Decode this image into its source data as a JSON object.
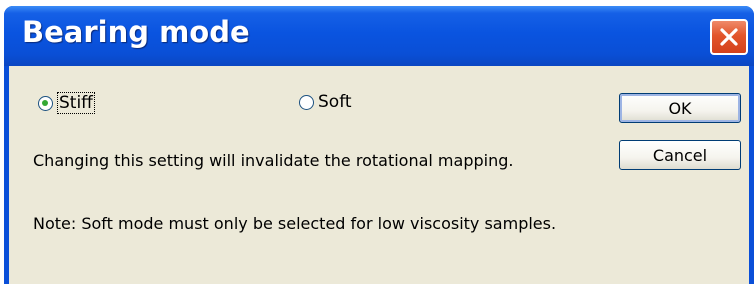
{
  "window": {
    "title": "Bearing mode",
    "close_icon": "close-icon"
  },
  "options": {
    "stiff_label": "Stiff",
    "soft_label": "Soft",
    "selected": "Stiff"
  },
  "buttons": {
    "ok_label": "OK",
    "cancel_label": "Cancel"
  },
  "messages": {
    "warning": "Changing this setting will invalidate the rotational mapping.",
    "note": "Note: Soft mode must only be selected for low viscosity samples."
  },
  "colors": {
    "titlebar": "#0a54e0",
    "client_bg": "#ece9d8",
    "close_button": "#e2552b",
    "radio_dot": "#34a834"
  }
}
